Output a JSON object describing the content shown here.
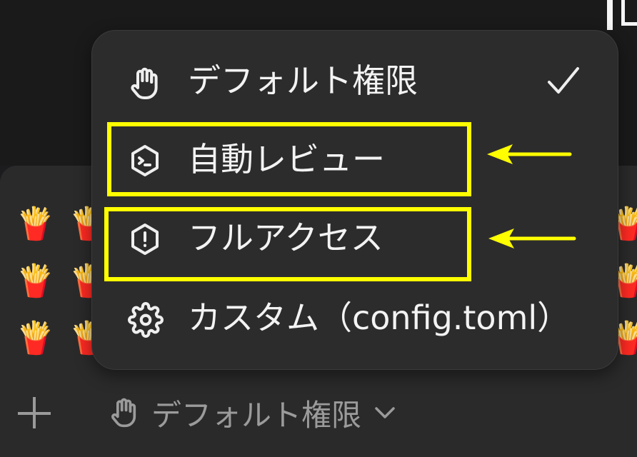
{
  "menu": {
    "items": [
      {
        "label": "デフォルト権限",
        "icon": "hand-icon",
        "checked": true
      },
      {
        "label": "自動レビュー",
        "icon": "terminal-shield-icon",
        "checked": false
      },
      {
        "label": "フルアクセス",
        "icon": "shield-alert-icon",
        "checked": false
      },
      {
        "label": "カスタム（config.toml）",
        "icon": "gear-icon",
        "checked": false
      }
    ]
  },
  "bottom_bar": {
    "mode_label": "デフォルト権限"
  },
  "background_emoji": "🍟",
  "colors": {
    "highlight": "#ffff00",
    "menu_background": "#2d2c2d",
    "panel_background": "#2b2a2b"
  }
}
